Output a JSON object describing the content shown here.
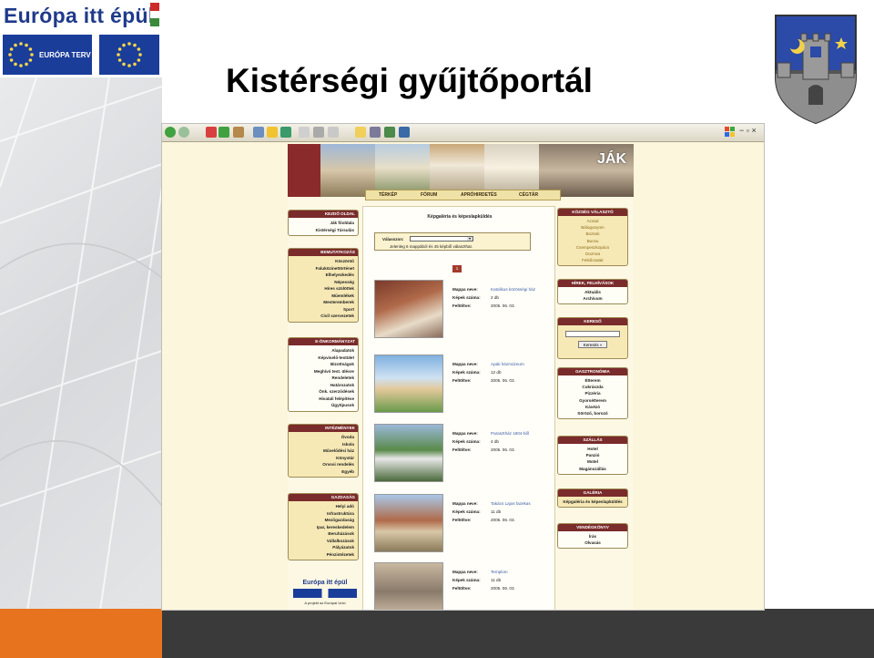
{
  "slide": {
    "logo_text": "Európa itt épül",
    "eu_badge_text": "EURÓPA TERV",
    "title": "Kistérségi gyűjtőportál"
  },
  "colors": {
    "bottom_bar": "#3a3a3a",
    "bottom_accent": "#e8731e",
    "logo_blue": "#1f3a8a",
    "site_menu_header": "#7a2b2b",
    "site_bg": "#fcf8e4"
  },
  "browser": {
    "toolbar_icons": [
      "back-icon",
      "forward-icon",
      "stop-icon",
      "refresh-icon",
      "home-icon",
      "search-icon",
      "favorites-icon",
      "history-icon",
      "mail-icon",
      "print-icon",
      "edit-icon",
      "discuss-icon",
      "messenger-icon",
      "folder-icon",
      "research-icon",
      "settings-icon"
    ]
  },
  "site": {
    "banner_title": "JÁK",
    "nav": [
      "TÉRKÉP",
      "FÓRUM",
      "APRÓHIRDETÉS",
      "CÉGTÁR"
    ],
    "left_menus": [
      {
        "header": "KEZDŐ OLDAL",
        "items": [
          "Ják főoldala",
          "Kistérségi Társulás"
        ],
        "white": true
      },
      {
        "header": "BEMUTATKOZÁS",
        "items": [
          "Köszöntő",
          "Faluközinettörténet",
          "Elhelyezkedés",
          "Népesség",
          "Híres szülöttek",
          "Műemlékek",
          "Mesteremberek",
          "Sport",
          "Civil szervezetek"
        ],
        "white": false
      },
      {
        "header": "E-ÖNKORMÁNYZAT",
        "items": [
          "Alapadatok",
          "Képviselő-testület",
          "Bizottságok",
          "Meghívó test. ülésre",
          "Rendeletek",
          "Határozatok",
          "Önk. szerződések",
          "Hivatali felépítése",
          "Ügytípusok"
        ],
        "white": true
      },
      {
        "header": "INTÉZMÉNYEK",
        "items": [
          "Óvoda",
          "Iskola",
          "Művelődési ház",
          "Könyvtár",
          "Orvosi rendelés",
          "Egyéb"
        ],
        "white": false
      },
      {
        "header": "GAZDASÁG",
        "items": [
          "Helyi adó",
          "Infrastruktúra",
          "Mezőgazdaság",
          "Ipar, kereskedelem",
          "Beruházások",
          "Vállalkozások",
          "Pályázatok",
          "Pénzintézetek"
        ],
        "white": false
      }
    ],
    "left_logo_text": "Európa itt épül",
    "left_logo_caption": "A projekt az Európai Unió",
    "right_menus": [
      {
        "header": "KÖZSÉG VÁLASZTÓ",
        "items": [
          "Acsád",
          "Bálogunyom",
          "Bozsok",
          "Bucsu",
          "Csempeszkopács",
          "Dozmat",
          "Felsőcsatár"
        ],
        "light": true,
        "white": false
      },
      {
        "header": "HÍREK, FELHÍVÁSOK",
        "items": [
          "Aktuális",
          "Archívum"
        ],
        "light": false,
        "white": true
      },
      {
        "header": "GASZTRONÓMIA",
        "items": [
          "Étterem",
          "Cukrászda",
          "Pizzéria",
          "Gyorsétterem",
          "Kávézó",
          "Söröző, borozó"
        ],
        "light": false,
        "white": true
      },
      {
        "header": "SZÁLLÁS",
        "items": [
          "Hotel",
          "Panzió",
          "Motel",
          "Magánszállás"
        ],
        "light": false,
        "white": true
      },
      {
        "header": "GALÉRIA",
        "items": [
          "Képgaléria és képeslapküldés"
        ],
        "light": false,
        "white": false
      },
      {
        "header": "VENDÉGKÖNYV",
        "items": [
          "Írás",
          "Olvasás"
        ],
        "light": false,
        "white": true
      }
    ],
    "search": {
      "header": "KERESŐ",
      "button": "Keresés »"
    },
    "gallery": {
      "title": "Képgaléria és képeslapküldés",
      "select_label": "Válasszon:",
      "select_value": "",
      "info": "Jelenleg 6 mappából és 45 képből választhat.",
      "page": "1",
      "label_folder": "Mappa neve:",
      "label_count": "Képek száma:",
      "label_date": "Feltöltve:",
      "entries": [
        {
          "name": "Katolikus közösségi ház",
          "count": "2 db",
          "date": "2005. 06. 03."
        },
        {
          "name": "Apáti házmúzeum",
          "count": "12 db",
          "date": "2005. 06. 03."
        },
        {
          "name": "Parasztház 1804-ből",
          "count": "4 db",
          "date": "2005. 06. 03."
        },
        {
          "name": "Takács Lajos fazekas",
          "count": "11 db",
          "date": "2005. 06. 03."
        },
        {
          "name": "Templom",
          "count": "11 db",
          "date": "2005. 06. 03."
        }
      ]
    }
  }
}
